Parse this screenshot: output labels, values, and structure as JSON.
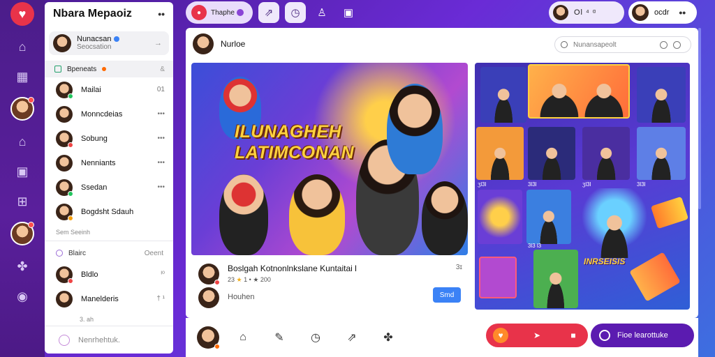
{
  "rail": {
    "logo_icon": "heart-icon",
    "items": [
      "home-icon",
      "grid-icon",
      "user-avatar",
      "house-icon",
      "image-icon",
      "layout-icon",
      "user-avatar-2",
      "puzzle-icon",
      "globe-icon"
    ]
  },
  "sidebar": {
    "title": "Nbara Mepaoiz",
    "more": "••",
    "me": {
      "name": "Nunacsan",
      "sub": "Seocsation",
      "chevron": "→"
    },
    "section": {
      "label": "Bpeneats",
      "right": "&"
    },
    "contacts": [
      {
        "name": "Mailai",
        "right": "01"
      },
      {
        "name": "Monncdeias",
        "right": "•••"
      },
      {
        "name": "Sobung",
        "right": "•••"
      },
      {
        "name": "Nenniants",
        "right": "•••"
      },
      {
        "name": "Ssedan",
        "right": "•••"
      },
      {
        "name": "Bogdsht Sdauh",
        "right": ""
      }
    ],
    "note": "Sem Seeinh",
    "group": {
      "label": "Blairc",
      "right": "Oeent"
    },
    "group_contacts": [
      {
        "name": "Bldlo",
        "right": "ᴵ⁰"
      },
      {
        "name": "Manelderis",
        "right": "† ¹"
      }
    ],
    "group_note": "3. ah",
    "footer": "Nenrhehtuk."
  },
  "topbar": {
    "active_tab": "Thaphe",
    "icons": [
      "share-icon",
      "clock-icon",
      "profile-icon",
      "notification-icon"
    ]
  },
  "topright": {
    "status": "Ol  ⁴ ᵅ"
  },
  "user": {
    "name": "ocdr",
    "more": "••"
  },
  "main": {
    "header_name": "Nurloe",
    "search_placeholder": "Nunansapeolt"
  },
  "post": {
    "headline": "ILUNAGHEH LATIMCONAN",
    "title": "Boslgah Kotnonlnkslane Kuntaitai l",
    "stats_prefix": "23",
    "star": "★",
    "stats_mid": "1  •",
    "stats_suffix": "★  200",
    "count": "3ɪ",
    "reply": "Houhen",
    "send_label": "Smd"
  },
  "gallery": {
    "labels": [
      "ʒl3l",
      "3l3l",
      "ʒl3l",
      "3l3l"
    ],
    "small_label": "3l3 l3",
    "banner": "INRSEISIS"
  },
  "bottom": {
    "icons": [
      "home-icon",
      "pen-icon",
      "clock-icon",
      "share-icon",
      "puzzle-icon"
    ],
    "actions": [
      "heart-icon",
      "send-icon",
      "lock-icon"
    ],
    "cta_label": "Fioe learottuke"
  },
  "colors": {
    "accent": "#e8334a",
    "purple": "#5b1bb0",
    "blue": "#3b82f6"
  }
}
